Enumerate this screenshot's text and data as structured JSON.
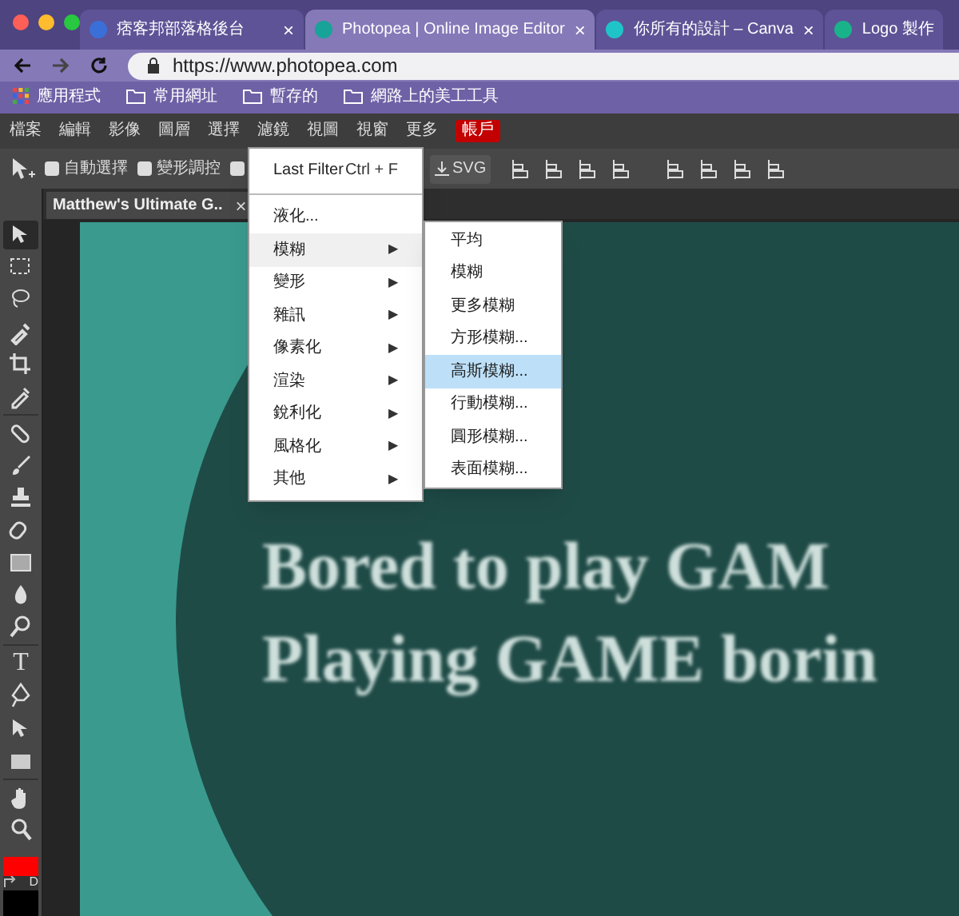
{
  "browser_tabs": [
    {
      "title": "痞客邦部落格後台",
      "selected": false,
      "close": "×"
    },
    {
      "title": "Photopea | Online Image Editor",
      "selected": true,
      "close": "×"
    },
    {
      "title": "你所有的設計 – Canva",
      "selected": false,
      "close": "×"
    },
    {
      "title": "Logo 製作",
      "selected": false
    }
  ],
  "address_bar": {
    "url": "https://www.photopea.com"
  },
  "bookmarks": [
    {
      "kind": "apps",
      "label": "應用程式"
    },
    {
      "kind": "folder",
      "label": "常用網址"
    },
    {
      "kind": "folder",
      "label": "暫存的"
    },
    {
      "kind": "folder",
      "label": "網路上的美工工具"
    }
  ],
  "menu_bar": [
    {
      "label": "檔案",
      "kind": "menu"
    },
    {
      "label": "編輯",
      "kind": "menu"
    },
    {
      "label": "影像",
      "kind": "menu"
    },
    {
      "label": "圖層",
      "kind": "menu"
    },
    {
      "label": "選擇",
      "kind": "menu"
    },
    {
      "label": "濾鏡",
      "kind": "menu"
    },
    {
      "label": "視圖",
      "kind": "menu"
    },
    {
      "label": "視窗",
      "kind": "menu"
    },
    {
      "label": "更多",
      "kind": "menu"
    },
    {
      "label": "帳戶",
      "kind": "account"
    }
  ],
  "options_bar": {
    "checkboxes": [
      {
        "label": "自動選擇",
        "checked": false
      },
      {
        "label": "變形調控",
        "checked": false
      },
      {
        "checked": false
      }
    ],
    "svg_button": "SVG"
  },
  "document_tab": {
    "title": "Matthew's Ultimate G..",
    "close": "×"
  },
  "tools": [
    {
      "kind": "move",
      "selected": true
    },
    {
      "kind": "marquee",
      "selected": false
    },
    {
      "kind": "lasso",
      "selected": false
    },
    {
      "kind": "quick-select",
      "selected": false
    },
    {
      "kind": "crop",
      "selected": false
    },
    {
      "kind": "eyedropper",
      "selected": false
    },
    {
      "kind": "heal",
      "selected": false
    },
    {
      "kind": "brush",
      "selected": false
    },
    {
      "kind": "stamp",
      "selected": false
    },
    {
      "kind": "eraser",
      "selected": false
    },
    {
      "kind": "gradient",
      "selected": false
    },
    {
      "kind": "blur",
      "selected": false
    },
    {
      "kind": "dodge",
      "selected": false
    },
    {
      "kind": "type",
      "label": "T",
      "selected": false
    },
    {
      "kind": "pen",
      "selected": false
    },
    {
      "kind": "path-select",
      "selected": false
    },
    {
      "kind": "shape",
      "selected": false
    },
    {
      "kind": "hand",
      "selected": false
    },
    {
      "kind": "zoom",
      "selected": false
    }
  ],
  "colors": {
    "default_label": "D"
  },
  "canvas": {
    "text_lines": [
      "Bored to play GAM",
      "Playing GAME borin"
    ]
  },
  "filter_menu": {
    "items": [
      {
        "kind": "command",
        "label": "Last Filter",
        "shortcut": "Ctrl + F"
      },
      {
        "kind": "separator"
      },
      {
        "kind": "command",
        "label": "液化..."
      },
      {
        "kind": "submenu",
        "label": "模糊",
        "expanded": true
      },
      {
        "kind": "submenu",
        "label": "變形",
        "expanded": false
      },
      {
        "kind": "submenu",
        "label": "雜訊",
        "expanded": false
      },
      {
        "kind": "submenu",
        "label": "像素化",
        "expanded": false
      },
      {
        "kind": "submenu",
        "label": "渲染",
        "expanded": false
      },
      {
        "kind": "submenu",
        "label": "銳利化",
        "expanded": false
      },
      {
        "kind": "submenu",
        "label": "風格化",
        "expanded": false
      },
      {
        "kind": "submenu",
        "label": "其他",
        "expanded": false
      }
    ],
    "arrow": "▶"
  },
  "blur_submenu": [
    {
      "label": "平均",
      "selected": false
    },
    {
      "label": "模糊",
      "selected": false
    },
    {
      "label": "更多模糊",
      "selected": false
    },
    {
      "label": "方形模糊...",
      "selected": false
    },
    {
      "label": "高斯模糊...",
      "selected": true
    },
    {
      "label": "行動模糊...",
      "selected": false
    },
    {
      "label": "圓形模糊...",
      "selected": false
    },
    {
      "label": "表面模糊...",
      "selected": false
    }
  ]
}
